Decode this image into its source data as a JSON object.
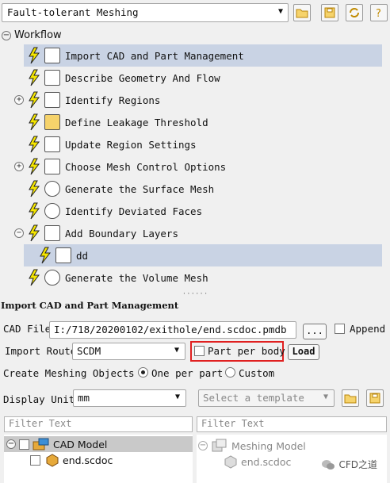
{
  "toolbar": {
    "workflow_select": "Fault-tolerant Meshing"
  },
  "tree": {
    "root_label": "Workflow",
    "items": [
      {
        "label": "Import CAD and Part Management",
        "icon": "cad-import-icon"
      },
      {
        "label": "Describe Geometry And Flow",
        "icon": "geometry-icon"
      },
      {
        "label": "Identify Regions",
        "icon": "regions-icon"
      },
      {
        "label": "Define Leakage Threshold",
        "icon": "leakage-icon"
      },
      {
        "label": "Update Region Settings",
        "icon": "region-settings-icon"
      },
      {
        "label": "Choose Mesh Control Options",
        "icon": "mesh-control-icon"
      },
      {
        "label": "Generate the Surface Mesh",
        "icon": "surface-mesh-icon"
      },
      {
        "label": "Identify Deviated Faces",
        "icon": "deviated-faces-icon"
      },
      {
        "label": "Add Boundary Layers",
        "icon": "boundary-layers-icon"
      },
      {
        "label": "dd",
        "icon": "boundary-layers-icon"
      },
      {
        "label": "Generate the Volume Mesh",
        "icon": "volume-mesh-icon"
      }
    ]
  },
  "panel": {
    "title": "Import CAD and Part Management",
    "cad_file_label": "CAD File",
    "cad_file_value": "I:/718/20200102/exithole/end.scdoc.pmdb",
    "browse_label": "...",
    "append_label": "Append",
    "import_route_label": "Import Route",
    "import_route_value": "SCDM",
    "part_per_body_label": "Part per body",
    "load_label": "Load",
    "create_objects_label": "Create Meshing Objects",
    "one_per_part_label": "One per part",
    "custom_label": "Custom",
    "display_unit_label": "Display Unit",
    "display_unit_value": "mm",
    "template_placeholder": "Select a template",
    "filter_left_placeholder": "Filter Text",
    "filter_right_placeholder": "Filter Text",
    "cad_tree": {
      "root": "CAD Model",
      "child": "end.scdoc"
    },
    "mesh_tree": {
      "root": "Meshing Model",
      "child": "end.scdoc"
    }
  },
  "watermark": "CFD之道",
  "colors": {
    "selection": "#c9d3e4",
    "bolt": "#f5e600",
    "highlight_box": "#e02020"
  }
}
